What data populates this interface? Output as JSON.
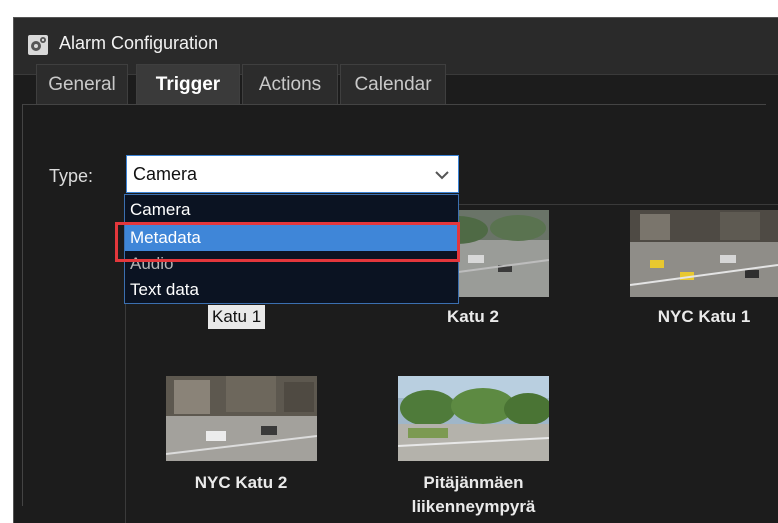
{
  "window": {
    "title": "Alarm Configuration"
  },
  "tabs": [
    {
      "label": "General",
      "active": false
    },
    {
      "label": "Trigger",
      "active": true
    },
    {
      "label": "Actions",
      "active": false
    },
    {
      "label": "Calendar",
      "active": false
    }
  ],
  "trigger": {
    "type_label": "Type:",
    "type_value": "Camera",
    "options": [
      "Camera",
      "Metadata",
      "Audio",
      "Text data"
    ],
    "hovered_option": "Metadata"
  },
  "cameras": [
    {
      "name": "Katu 1",
      "selected": true
    },
    {
      "name": "Katu 2",
      "selected": false
    },
    {
      "name": "NYC Katu 1",
      "selected": false
    },
    {
      "name": "NYC Katu 2",
      "selected": false
    },
    {
      "name": "Pitäjänmäen liikenneympyrä",
      "name_line1": "Pitäjänmäen",
      "name_line2": "liikenneympyrä",
      "selected": false
    }
  ],
  "colors": {
    "window_bg": "#1c1c1c",
    "accent_blue": "#3f86d8",
    "callout_red": "#e3373c"
  },
  "icons": {
    "window": "settings-gear-icon",
    "dropdown": "chevron-down-icon"
  }
}
